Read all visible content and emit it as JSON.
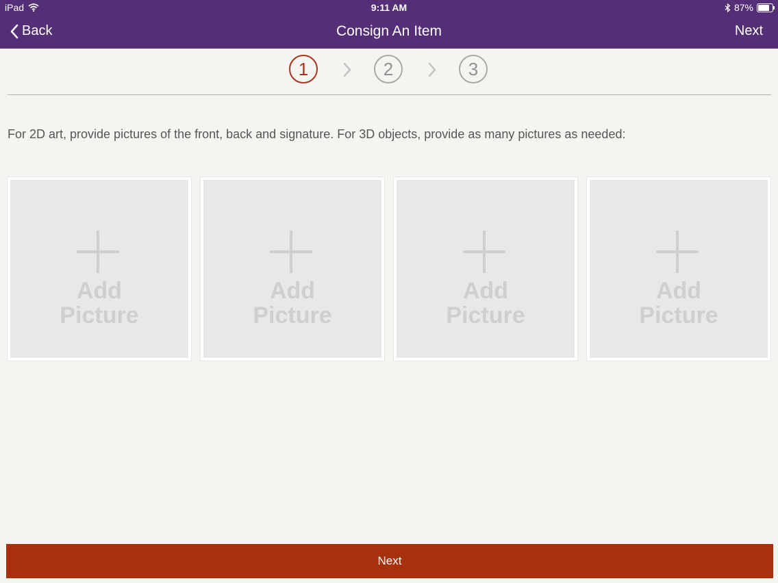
{
  "status_bar": {
    "device": "iPad",
    "time": "9:11 AM",
    "battery_percent_label": "87%",
    "battery_level": 0.87
  },
  "nav": {
    "back_label": "Back",
    "title": "Consign An Item",
    "next_label": "Next"
  },
  "steps": [
    "1",
    "2",
    "3"
  ],
  "active_step": 1,
  "instructions": "For 2D art, provide pictures of the front, back and signature.  For 3D objects, provide as many pictures as needed:",
  "picture_slots": [
    {
      "line1": "Add",
      "line2": "Picture"
    },
    {
      "line1": "Add",
      "line2": "Picture"
    },
    {
      "line1": "Add",
      "line2": "Picture"
    },
    {
      "line1": "Add",
      "line2": "Picture"
    }
  ],
  "bottom_button": {
    "label": "Next"
  },
  "colors": {
    "nav_bar": "#552e78",
    "active_step": "#a8321a",
    "primary_button": "#a6310c",
    "background": "#f5f4f1"
  }
}
